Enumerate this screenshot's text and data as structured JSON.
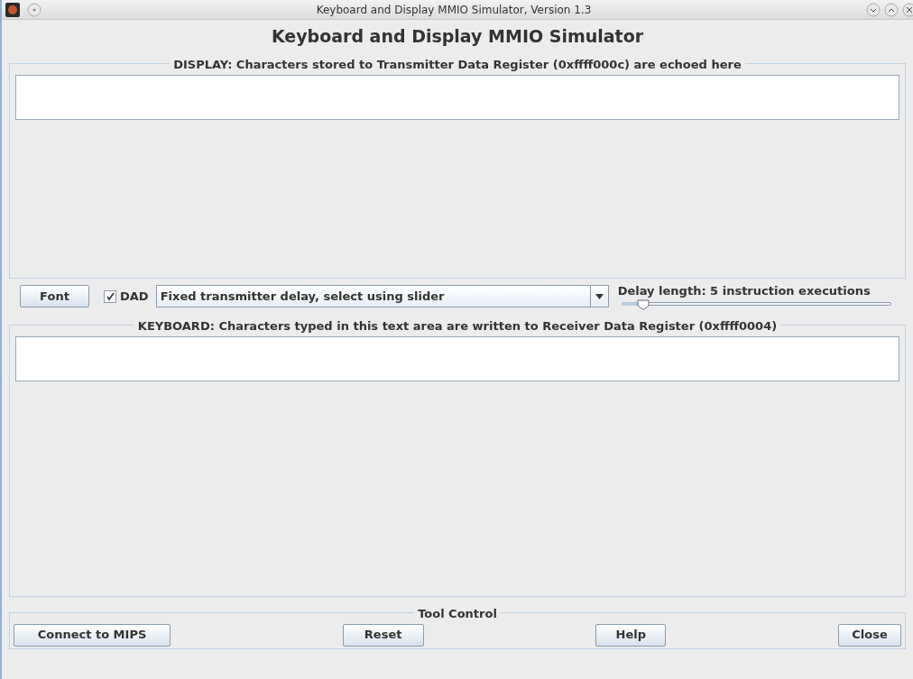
{
  "window": {
    "title": "Keyboard and Display MMIO Simulator, Version 1.3"
  },
  "heading": "Keyboard and Display MMIO Simulator",
  "display": {
    "legend": "DISPLAY: Characters stored to Transmitter Data Register (0xffff000c) are echoed here"
  },
  "controls": {
    "font_button": "Font",
    "dad": {
      "label": "DAD",
      "checked": true
    },
    "delay_mode": {
      "value": "Fixed transmitter delay, select using slider"
    },
    "delay": {
      "label": "Delay length: 5 instruction executions",
      "level": 0.08
    }
  },
  "keyboard": {
    "legend": "KEYBOARD: Characters typed in this text area are written to Receiver Data Register (0xffff0004)"
  },
  "tool_control": {
    "legend": "Tool Control",
    "buttons": [
      "Connect to MIPS",
      "Reset",
      "Help",
      "Close"
    ]
  }
}
